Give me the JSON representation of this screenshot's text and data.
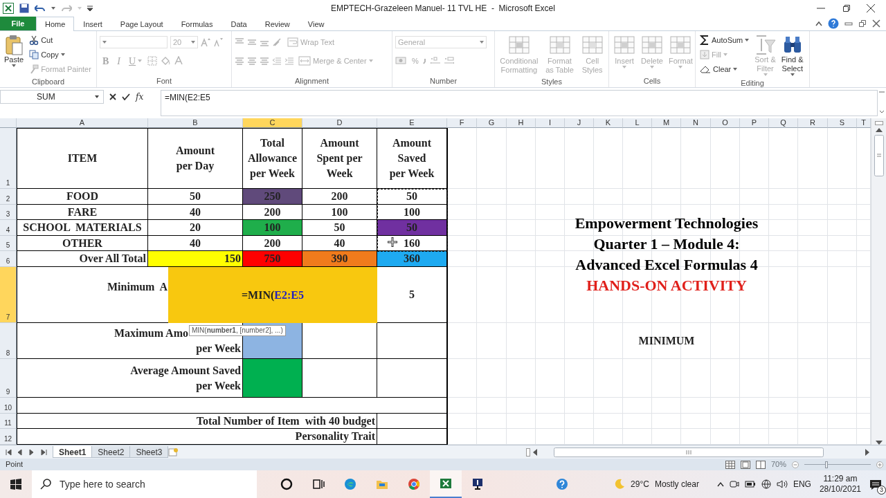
{
  "window": {
    "title": "EMPTECH-Grazeleen Manuel- 11 TVL HE  -  Microsoft Excel"
  },
  "ribbon_tabs": [
    {
      "label": "File",
      "kind": "file",
      "selected": false
    },
    {
      "label": "Home",
      "kind": "tab",
      "selected": true
    },
    {
      "label": "Insert",
      "kind": "tab",
      "selected": false
    },
    {
      "label": "Page Layout",
      "kind": "tab",
      "selected": false
    },
    {
      "label": "Formulas",
      "kind": "tab",
      "selected": false
    },
    {
      "label": "Data",
      "kind": "tab",
      "selected": false
    },
    {
      "label": "Review",
      "kind": "tab",
      "selected": false
    },
    {
      "label": "View",
      "kind": "tab",
      "selected": false
    }
  ],
  "ribbon": {
    "groups": [
      {
        "label": "Clipboard",
        "kind": "clipboard",
        "buttons": [
          {
            "label": "Paste",
            "disabled": false
          },
          {
            "label": "Cut",
            "disabled": false
          },
          {
            "label": "Copy",
            "disabled": false
          },
          {
            "label": "Format Painter",
            "disabled": true
          }
        ]
      },
      {
        "label": "Font",
        "kind": "font",
        "font_size": "20",
        "buttons": [
          {
            "label": "B",
            "disabled": true
          },
          {
            "label": "I",
            "disabled": true
          },
          {
            "label": "U",
            "disabled": true
          }
        ]
      },
      {
        "label": "Alignment",
        "kind": "alignment",
        "buttons": [
          {
            "label": "Wrap Text",
            "disabled": true
          },
          {
            "label": "Merge & Center",
            "disabled": true
          }
        ]
      },
      {
        "label": "Number",
        "kind": "number",
        "format": "General",
        "buttons": [
          {
            "label": "%",
            "disabled": true
          }
        ]
      },
      {
        "label": "Styles",
        "kind": "styles",
        "buttons": [
          {
            "label": "Conditional\nFormatting",
            "disabled": true
          },
          {
            "label": "Format\nas Table",
            "disabled": true
          },
          {
            "label": "Cell\nStyles",
            "disabled": true
          }
        ]
      },
      {
        "label": "Cells",
        "kind": "cells",
        "buttons": [
          {
            "label": "Insert",
            "disabled": true
          },
          {
            "label": "Delete",
            "disabled": true
          },
          {
            "label": "Format",
            "disabled": true
          }
        ]
      },
      {
        "label": "Editing",
        "kind": "editing",
        "buttons": [
          {
            "label": "AutoSum",
            "disabled": false
          },
          {
            "label": "Fill",
            "disabled": true
          },
          {
            "label": "Clear",
            "disabled": false
          },
          {
            "label": "Sort &\nFilter",
            "disabled": true
          },
          {
            "label": "Find &\nSelect",
            "disabled": false
          }
        ]
      }
    ]
  },
  "formula_bar": {
    "name_box": "SUM",
    "function_label": "fx",
    "formula": "=MIN(E2:E5"
  },
  "sheet": {
    "columns": [
      {
        "letter": "A",
        "selected": false
      },
      {
        "letter": "B",
        "selected": false
      },
      {
        "letter": "C",
        "selected": true
      },
      {
        "letter": "D",
        "selected": false
      },
      {
        "letter": "E",
        "selected": false
      },
      {
        "letter": "F",
        "selected": false
      },
      {
        "letter": "G",
        "selected": false
      },
      {
        "letter": "H",
        "selected": false
      },
      {
        "letter": "I",
        "selected": false
      },
      {
        "letter": "J",
        "selected": false
      },
      {
        "letter": "K",
        "selected": false
      },
      {
        "letter": "L",
        "selected": false
      },
      {
        "letter": "M",
        "selected": false
      },
      {
        "letter": "N",
        "selected": false
      },
      {
        "letter": "O",
        "selected": false
      },
      {
        "letter": "P",
        "selected": false
      },
      {
        "letter": "Q",
        "selected": false
      },
      {
        "letter": "R",
        "selected": false
      },
      {
        "letter": "S",
        "selected": false
      },
      {
        "letter": "T",
        "selected": false
      }
    ],
    "rows": [
      {
        "number": "1",
        "selected": false,
        "cells": [
          {
            "text": "ITEM"
          },
          {
            "text": "Amount\nper Day"
          },
          {
            "text": "Total\nAllowance\nper Week"
          },
          {
            "text": "Amount\nSpent per\nWeek"
          },
          {
            "text": "Amount\nSaved\nper Week"
          }
        ]
      },
      {
        "number": "2",
        "selected": false,
        "cells": [
          {
            "text": "FOOD"
          },
          {
            "text": "50"
          },
          {
            "text": "250",
            "color": "#604a7b"
          },
          {
            "text": "200"
          },
          {
            "text": "50"
          }
        ]
      },
      {
        "number": "3",
        "selected": false,
        "cells": [
          {
            "text": "FARE"
          },
          {
            "text": "40"
          },
          {
            "text": "200"
          },
          {
            "text": "100"
          },
          {
            "text": "100"
          }
        ]
      },
      {
        "number": "4",
        "selected": false,
        "cells": [
          {
            "text": "SCHOOL  MATERIALS"
          },
          {
            "text": "20"
          },
          {
            "text": "100",
            "color": "#1fae4b"
          },
          {
            "text": "50"
          },
          {
            "text": "50",
            "color": "#7030a0"
          }
        ]
      },
      {
        "number": "5",
        "selected": false,
        "cells": [
          {
            "text": "OTHER"
          },
          {
            "text": "40"
          },
          {
            "text": "200"
          },
          {
            "text": "40"
          },
          {
            "text": "160"
          }
        ]
      },
      {
        "number": "6",
        "selected": false,
        "cells": [
          {
            "text": "Over All Total"
          },
          {
            "text": "150",
            "color": "#ffff00"
          },
          {
            "text": "750",
            "color": "#ff0000"
          },
          {
            "text": "390",
            "color": "#f07b1c"
          },
          {
            "text": "360",
            "color": "#1eaaf1"
          }
        ]
      },
      {
        "number": "7",
        "selected": true,
        "cells": [
          {
            "colspan": 2,
            "text": "Minimum  A"
          },
          {
            "text": ""
          },
          {
            "text": ""
          },
          {
            "text": "5"
          }
        ]
      },
      {
        "number": "8",
        "selected": false,
        "cells": [
          {
            "colspan": 2,
            "text": "Maximum Amo\nper Week"
          },
          {
            "text": "",
            "color": "#8db4e2"
          },
          {
            "text": ""
          },
          {
            "text": ""
          }
        ]
      },
      {
        "number": "9",
        "selected": false,
        "cells": [
          {
            "colspan": 2,
            "text": "Average Amount Saved\nper Week"
          },
          {
            "text": "",
            "color": "#00b050"
          },
          {
            "text": ""
          },
          {
            "text": ""
          }
        ]
      },
      {
        "number": "10",
        "selected": false,
        "cells": [
          {
            "colspan": 5,
            "text": ""
          }
        ]
      },
      {
        "number": "11",
        "selected": false,
        "cells": [
          {
            "colspan": 4,
            "text": "Total Number of Item  with 40 budget"
          },
          {
            "text": ""
          }
        ]
      },
      {
        "number": "12",
        "selected": false,
        "cells": [
          {
            "colspan": 4,
            "text": "Personality Trait"
          },
          {
            "text": ""
          }
        ]
      }
    ]
  },
  "cell_editor": {
    "parts": [
      {
        "text": "=MIN(",
        "kind": "plain"
      },
      {
        "text": "E2:E5",
        "kind": "reference"
      }
    ]
  },
  "tooltip": {
    "text": "MIN(**number1**, [number2], ...)"
  },
  "text_box": {
    "lines": [
      {
        "text": "Empowerment Technologies",
        "color": "#000000"
      },
      {
        "text": "Quarter 1 – Module 4:",
        "color": "#000000"
      },
      {
        "text": "Advanced Excel Formulas 4",
        "color": "#000000"
      },
      {
        "text": "HANDS-ON ACTIVITY",
        "color": "#e0201b"
      }
    ]
  },
  "section_label": {
    "text": "MINIMUM"
  },
  "sheet_tabs": [
    {
      "label": "Sheet1",
      "selected": true
    },
    {
      "label": "Sheet2",
      "selected": false
    },
    {
      "label": "Sheet3",
      "selected": false
    }
  ],
  "status_bar": {
    "mode": "Point",
    "zoom": "70%",
    "zoom_slider": {
      "level": 0.33
    }
  },
  "taskbar": {
    "search_placeholder": "Type here to search",
    "apps": [
      {
        "kind": "cortana",
        "selected": false
      },
      {
        "kind": "task_view",
        "selected": false
      },
      {
        "kind": "edge",
        "selected": false
      },
      {
        "kind": "explorer",
        "selected": false
      },
      {
        "kind": "chrome",
        "selected": false
      },
      {
        "kind": "excel",
        "selected": true
      },
      {
        "kind": "app",
        "selected": false
      }
    ],
    "temperature": "29°C",
    "weather": "Mostly clear",
    "language": "ENG",
    "time": "11:29 am",
    "date": "28/10/2021",
    "notifications": "3"
  }
}
